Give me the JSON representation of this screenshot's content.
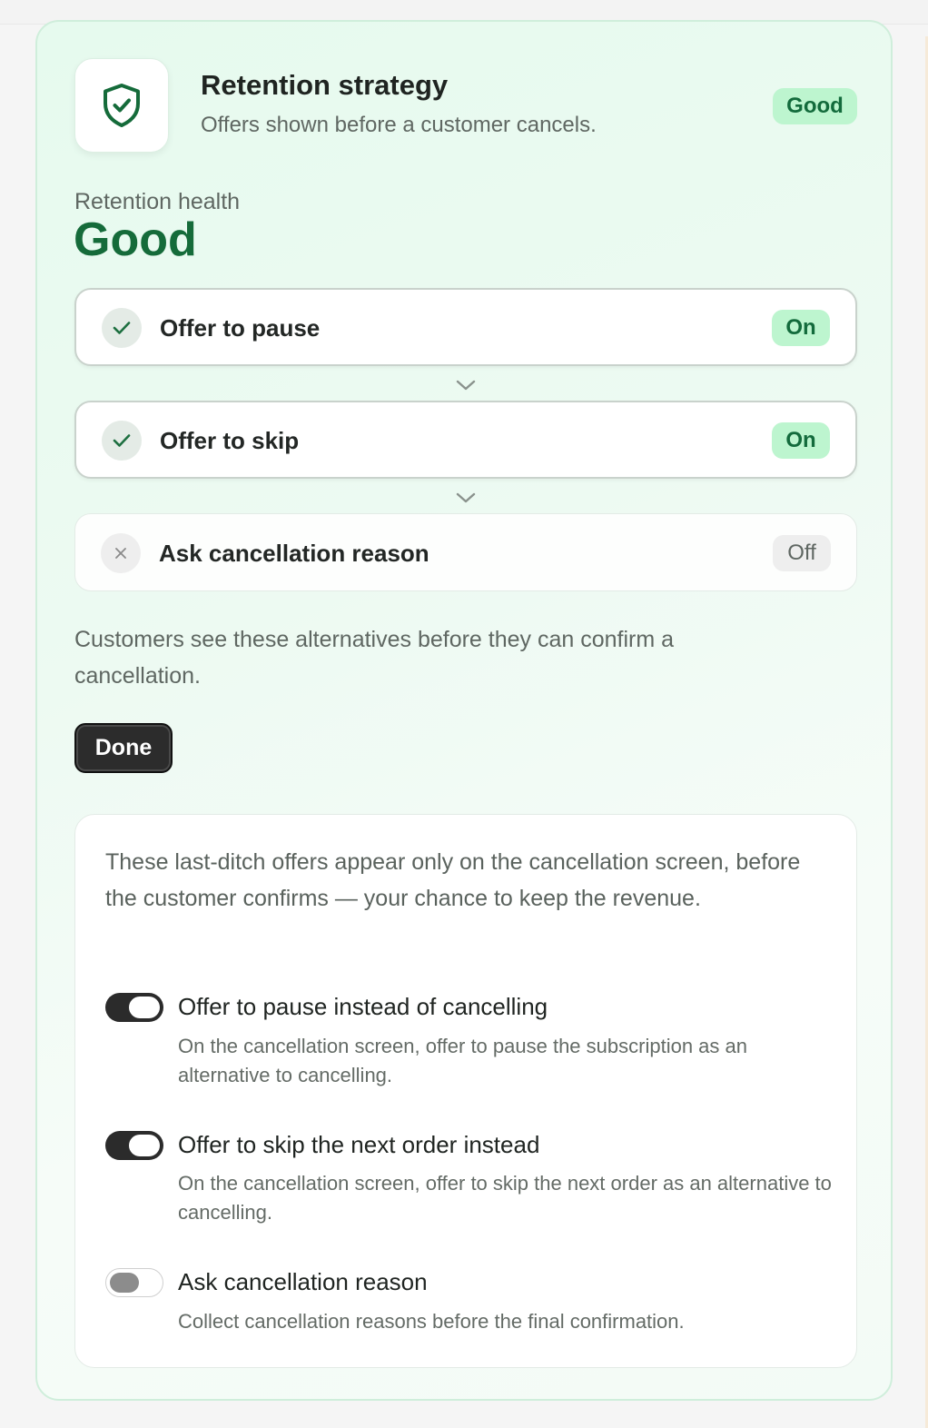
{
  "header": {
    "title": "Retention strategy",
    "subtitle": "Offers shown before a customer cancels.",
    "status": "Good",
    "icon": "shield-check-icon"
  },
  "health": {
    "label": "Retention health",
    "value": "Good"
  },
  "steps": [
    {
      "label": "Offer to pause",
      "state": "On",
      "icon": "check-icon"
    },
    {
      "label": "Offer to skip",
      "state": "On",
      "icon": "check-icon"
    },
    {
      "label": "Ask cancellation reason",
      "state": "Off",
      "icon": "x-icon"
    }
  ],
  "description": "Customers see these alternatives before they can confirm a cancellation.",
  "done_label": "Done",
  "settings": {
    "intro": "These last-ditch offers appear only on the cancellation screen, before the customer confirms — your chance to keep the revenue.",
    "options": [
      {
        "title": "Offer to pause instead of cancelling",
        "description": "On the cancellation screen, offer to pause the subscription as an alternative to cancelling.",
        "enabled": true
      },
      {
        "title": "Offer to skip the next order instead",
        "description": "On the cancellation screen, offer to skip the next order as an alternative to cancelling.",
        "enabled": true
      },
      {
        "title": "Ask cancellation reason",
        "description": "Collect cancellation reasons before the final confirmation.",
        "enabled": false
      }
    ]
  },
  "colors": {
    "accent_green": "#156b3a",
    "badge_green_bg": "#bdf5cf",
    "card_bg": "#e6faee",
    "button_dark": "#2c2c2c"
  }
}
